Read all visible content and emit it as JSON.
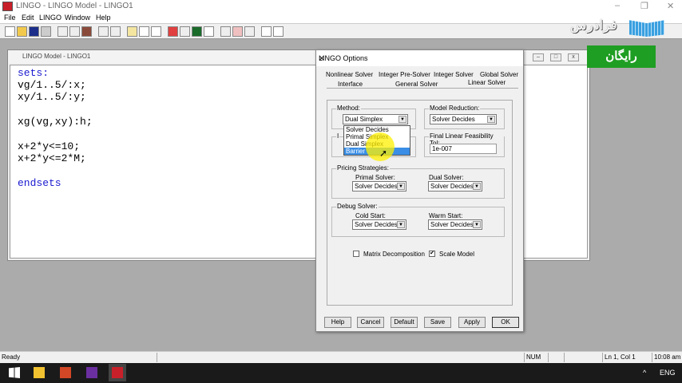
{
  "app": {
    "title": "LINGO - LINGO Model - LINGO1"
  },
  "menu": [
    "File",
    "Edit",
    "LINGO",
    "Window",
    "Help"
  ],
  "model_window": {
    "title": "LINGO Model - LINGO1",
    "lines": [
      "sets:",
      "vg/1..5/:x;",
      "xy/1..5/:y;",
      "xg(vg,xy):h;",
      "x+2*y<=10;",
      "x+2*y<=2*M;",
      "endsets"
    ]
  },
  "dialog": {
    "title": "LINGO Options",
    "tabs_row1": [
      "Nonlinear Solver",
      "Integer Pre-Solver",
      "Integer Solver",
      "Global Solver"
    ],
    "tabs_row2": [
      "Interface",
      "General Solver",
      "Linear Solver"
    ],
    "method": {
      "label": "Method:",
      "value": "Dual Simplex",
      "options": [
        "Solver Decides",
        "Primal Simplex",
        "Dual Simplex",
        "Barrier"
      ],
      "highlighted": "Barrier"
    },
    "model_reduction": {
      "label": "Model Reduction:",
      "value": "Solver Decides"
    },
    "initial_label": "I",
    "feas_tol": {
      "label": "Final Linear Feasibility Tol:",
      "value": "1e-007"
    },
    "pricing": {
      "label": "Pricing Strategies:",
      "primal_label": "Primal Solver:",
      "primal_value": "Solver Decides",
      "dual_label": "Dual Solver:",
      "dual_value": "Solver Decides"
    },
    "debug": {
      "label": "Debug Solver:",
      "cold_label": "Cold Start:",
      "cold_value": "Solver Decides",
      "warm_label": "Warm Start:",
      "warm_value": "Solver Decides"
    },
    "matrix_decomp": {
      "label": "Matrix Decomposition",
      "checked": false
    },
    "scale_model": {
      "label": "Scale Model",
      "checked": true
    },
    "buttons": [
      "Help",
      "Cancel",
      "Default",
      "Save",
      "Apply",
      "OK"
    ]
  },
  "status": {
    "ready": "Ready",
    "num": "NUM",
    "pos": "Ln 1, Col 1",
    "time": "10:08 am"
  },
  "taskbar": {
    "lang": "ENG",
    "chevron": "^"
  },
  "watermark": {
    "logo": "فرادرس",
    "badge": "رایگان"
  },
  "colors": {
    "accent": "#3a8ee6",
    "badge": "#1e9e22"
  }
}
